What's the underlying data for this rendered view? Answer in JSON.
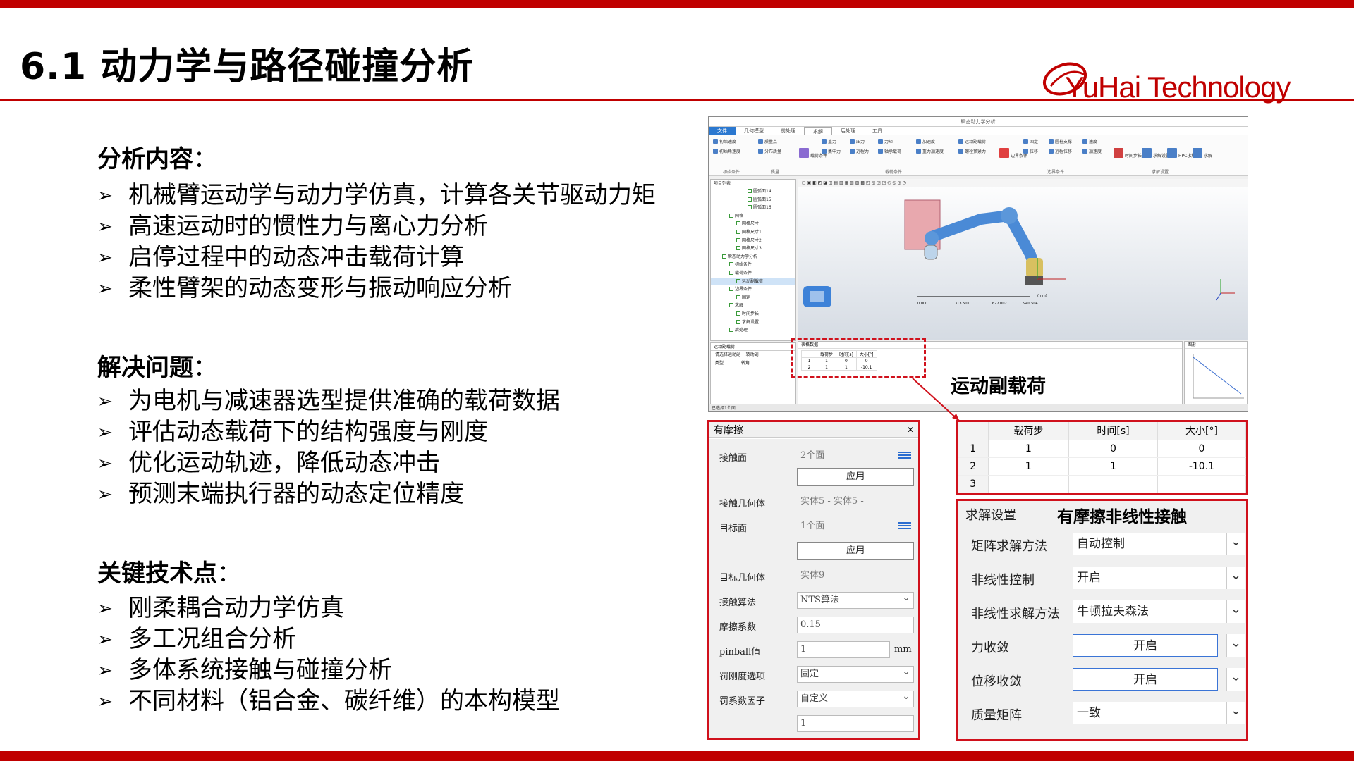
{
  "page": {
    "title": "6.1 动力学与路径碰撞分析",
    "logo_text": "YuHai Technology",
    "brand_color": "#c00000"
  },
  "sections": [
    {
      "heading": "分析内容",
      "items": [
        "机械臂运动学与动力学仿真，计算各关节驱动力矩",
        "高速运动时的惯性力与离心力分析",
        "启停过程中的动态冲击载荷计算",
        "柔性臂架的动态变形与振动响应分析"
      ]
    },
    {
      "heading": "解决问题",
      "items": [
        "为电机与减速器选型提供准确的载荷数据",
        "评估动态载荷下的结构强度与刚度",
        "优化运动轨迹，降低动态冲击",
        "预测末端执行器的动态定位精度"
      ]
    },
    {
      "heading": "关键技术点",
      "items": [
        "刚柔耦合动力学仿真",
        "多工况组合分析",
        "多体系统接触与碰撞分析",
        "不同材料（铝合金、碳纤维）的本构模型"
      ]
    }
  ],
  "software": {
    "window_title": "瞬态动力学分析",
    "menu": [
      "文件",
      "几何模型",
      "前处理",
      "求解",
      "后处理",
      "工具"
    ],
    "active_menu": "求解",
    "ribbon": {
      "buttons": [
        "初始速度",
        "质量点",
        "重力",
        "压力",
        "力矩",
        "加速度",
        "运动副载荷",
        "固定",
        "圆柱支撑",
        "速度",
        "初始角速度",
        "分布质量",
        "载荷条件",
        "集中力",
        "远程力",
        "轴承载荷",
        "重力加速度",
        "螺栓预紧力",
        "边界条件",
        "位移",
        "远程位移",
        "加速度",
        "时间步长",
        "求解设置",
        "HPC求解",
        "求解"
      ],
      "groups": [
        "初始条件",
        "质量",
        "载荷条件",
        "边界条件",
        "求解设置"
      ]
    },
    "tree_header": "项目列表",
    "tree_items": [
      "圆弧面14",
      "圆弧面15",
      "圆弧面16",
      "网格",
      "网格尺寸",
      "网格尺寸1",
      "网格尺寸2",
      "网格尺寸3",
      "瞬态动力学分析",
      "初始条件",
      "载荷条件",
      "运动副载荷",
      "边界条件",
      "固定",
      "求解",
      "时间步长",
      "求解设置",
      "后处理"
    ],
    "prop_header": "运动副载荷",
    "prop_rows": [
      [
        "请选择运动副",
        "转动副"
      ],
      [
        "类型",
        "转角"
      ]
    ],
    "grid_header": "表格数据",
    "chart_header": "图形",
    "status_text": "已选择1个面",
    "scale_labels": [
      "0.000",
      "313.501",
      "627.002",
      "940.504"
    ],
    "scale_unit": "(mm)"
  },
  "callout": "运动副载荷",
  "friction": {
    "title": "有摩擦",
    "contact_face_label": "接触面",
    "contact_face_value": "2个面",
    "apply_label": "应用",
    "contact_body_label": "接触几何体",
    "contact_body_value": "实体5 - 实体5 -",
    "target_face_label": "目标面",
    "target_face_value": "1个面",
    "target_body_label": "目标几何体",
    "target_body_value": "实体9",
    "algo_label": "接触算法",
    "algo_value": "NTS算法",
    "friction_label": "摩擦系数",
    "friction_value": "0.15",
    "pinball_label": "pinball值",
    "pinball_value": "1",
    "pinball_unit": "mm",
    "stiff_label": "罚刚度选项",
    "stiff_value": "固定",
    "factor_label": "罚系数因子",
    "factor_value": "自定义",
    "factor_input": "1"
  },
  "load_table": {
    "headers": [
      "载荷步",
      "时间[s]",
      "大小[°]"
    ],
    "rows": [
      [
        "1",
        "1",
        "0",
        "0"
      ],
      [
        "2",
        "1",
        "1",
        "-10.1"
      ],
      [
        "3",
        "",
        "",
        ""
      ]
    ]
  },
  "solver": {
    "tab": "求解设置",
    "title": "有摩擦非线性接触",
    "rows": [
      {
        "label": "矩阵求解方法",
        "value": "自动控制"
      },
      {
        "label": "非线性控制",
        "value": "开启"
      },
      {
        "label": "非线性求解方法",
        "value": "牛顿拉夫森法"
      },
      {
        "label": "力收敛",
        "value": "开启"
      },
      {
        "label": "位移收敛",
        "value": "开启"
      },
      {
        "label": "质量矩阵",
        "value": "一致"
      }
    ]
  }
}
